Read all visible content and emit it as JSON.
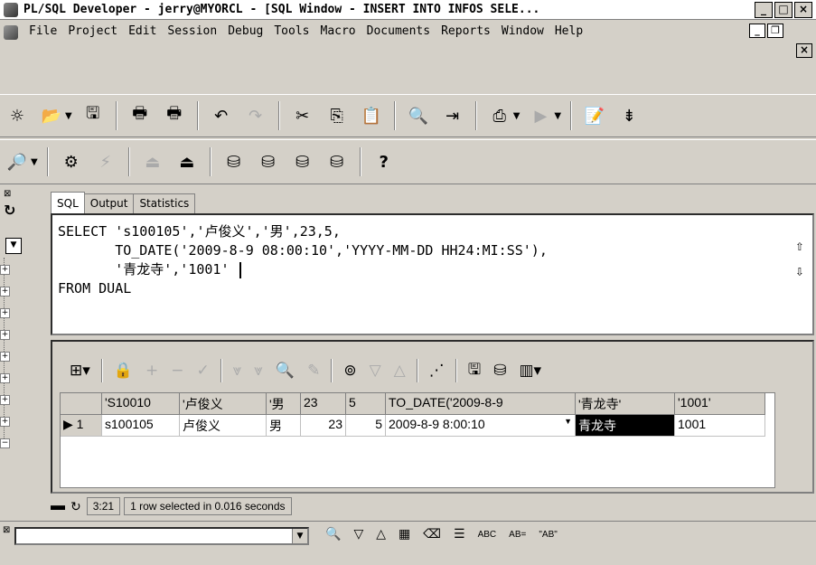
{
  "window": {
    "title": "PL/SQL Developer - jerry@MYORCL - [SQL Window - INSERT INTO INFOS SELE...",
    "buttons": [
      "_",
      "□",
      "×"
    ]
  },
  "menu": {
    "items": [
      "File",
      "Project",
      "Edit",
      "Session",
      "Debug",
      "Tools",
      "Macro",
      "Documents",
      "Reports",
      "Window",
      "Help"
    ]
  },
  "tabs": [
    "SQL",
    "Output",
    "Statistics"
  ],
  "editor": {
    "lines": [
      "SELECT '",
      "s100105',",
      "'卢俊义','男',23,5,",
      "TO_DATE('2009-8-9 08:00:10','YYYY-MM-DD HH24:MI:SS'),",
      "'青龙寺','1001'",
      "FROM DUAL"
    ],
    "line1": "SELECT 's100105','卢俊义','男',23,5,",
    "line2": "       TO_DATE('2009-8-9 08:00:10','YYYY-MM-DD HH24:MI:SS'),",
    "line3": "       '青龙寺','1001' ",
    "line4": "FROM DUAL"
  },
  "grid": {
    "headers": [
      "'S10010",
      "'卢俊义",
      "'男",
      "23",
      "5",
      "TO_DATE('2009-8-9",
      "'青龙寺'",
      "'1001'"
    ],
    "rows": [
      {
        "rownum": "1",
        "cells": [
          "s100105",
          "卢俊义",
          "男",
          "23",
          "5",
          "2009-8-9 8:00:10",
          "青龙寺",
          "1001"
        ]
      }
    ]
  },
  "status": {
    "position": "3:21",
    "message": "1 row selected in 0.016 seconds"
  },
  "find": {
    "value": "",
    "abc_label": "ABC",
    "ab_label": "\"AB\""
  }
}
